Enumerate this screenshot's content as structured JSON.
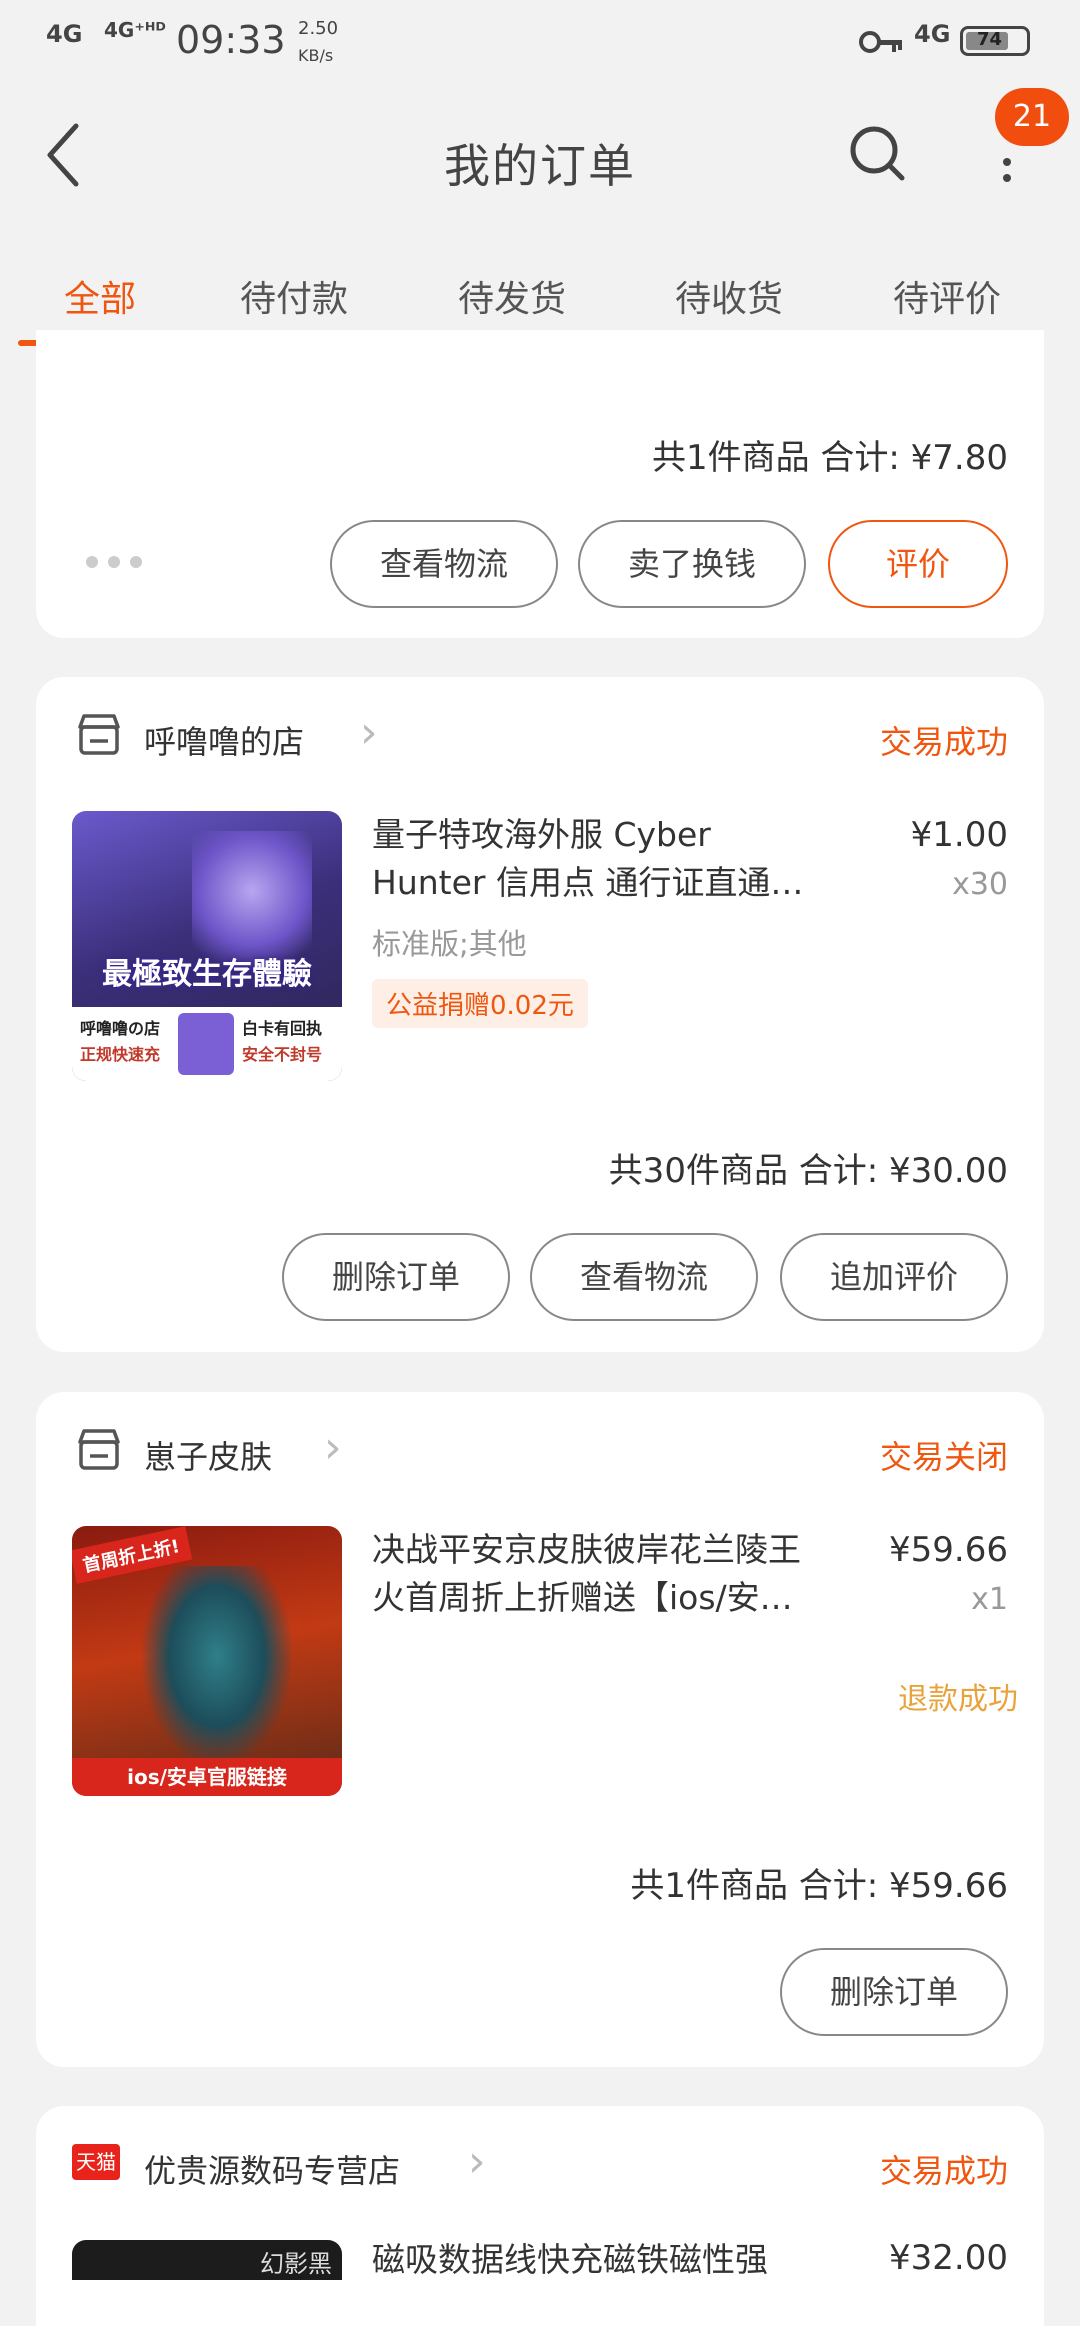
{
  "status_bar": {
    "signal1": "4G",
    "signal2": "4G⁺ᴴᴰ",
    "time": "09:33",
    "speed_top": "2.50",
    "speed_bottom": "KB/s",
    "net": "4G",
    "battery": "74"
  },
  "header": {
    "title": "我的订单",
    "badge": "21"
  },
  "tabs": [
    "全部",
    "待付款",
    "待发货",
    "待收货",
    "待评价"
  ],
  "order0": {
    "summary": "共1件商品  合计: ¥7.80",
    "buttons": [
      "查看物流",
      "卖了换钱",
      "评价"
    ]
  },
  "order1": {
    "store": "呼噜噜的店",
    "status": "交易成功",
    "title_line1": "量子特攻海外服 Cyber",
    "title_line2": "Hunter 信用点 通行证直通…",
    "variant": "标准版;其他",
    "charity": "公益捐赠0.02元",
    "price": "¥1.00",
    "qty": "x30",
    "summary": "共30件商品  合计: ¥30.00",
    "buttons": [
      "删除订单",
      "查看物流",
      "追加评价"
    ],
    "thumb_text": [
      "最極致生存體驗",
      "呼噜噜の店",
      "正规快速充",
      "白卡有回执",
      "安全不封号"
    ]
  },
  "order2": {
    "store": "崽子皮肤",
    "status": "交易关闭",
    "title_line1": "决战平安京皮肤彼岸花兰陵王",
    "title_line2": "火首周折上折赠送【ios/安…",
    "price": "¥59.66",
    "qty": "x1",
    "refund": "退款成功",
    "summary": "共1件商品  合计: ¥59.66",
    "buttons": [
      "删除订单"
    ],
    "thumb_text": [
      "首周折上折!",
      "ios/安卓官服链接"
    ]
  },
  "order3": {
    "store_tag": "天猫",
    "store": "优贵源数码专营店",
    "status": "交易成功",
    "title_line1": "磁吸数据线快充磁铁磁性强",
    "price": "¥32.00",
    "thumb_text": [
      "幻影黑"
    ]
  },
  "colors": {
    "accent": "#f0560f",
    "background": "#f2f2f2",
    "refund": "#e8a33d"
  }
}
